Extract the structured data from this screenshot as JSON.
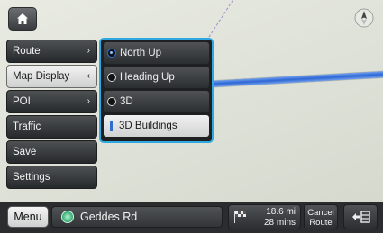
{
  "left_menu": {
    "items": [
      {
        "label": "Route",
        "chevron": "›"
      },
      {
        "label": "Map Display",
        "chevron": "‹"
      },
      {
        "label": "POI",
        "chevron": "›"
      },
      {
        "label": "Traffic",
        "chevron": ""
      },
      {
        "label": "Save",
        "chevron": ""
      },
      {
        "label": "Settings",
        "chevron": ""
      }
    ],
    "selected_index": 1
  },
  "map_display_submenu": {
    "options": [
      {
        "label": "North Up",
        "type": "radio",
        "selected": true
      },
      {
        "label": "Heading Up",
        "type": "radio",
        "selected": false
      },
      {
        "label": "3D",
        "type": "radio",
        "selected": false
      },
      {
        "label": "3D Buildings",
        "type": "toggle",
        "selected": true
      }
    ],
    "accent_color": "#2fa7e0"
  },
  "bottom_bar": {
    "menu_label": "Menu",
    "street_name": "Geddes Rd",
    "distance": "18.6 mi",
    "time": "28 mins",
    "cancel_line1": "Cancel",
    "cancel_line2": "Route"
  },
  "route_color": "#2f66d4"
}
